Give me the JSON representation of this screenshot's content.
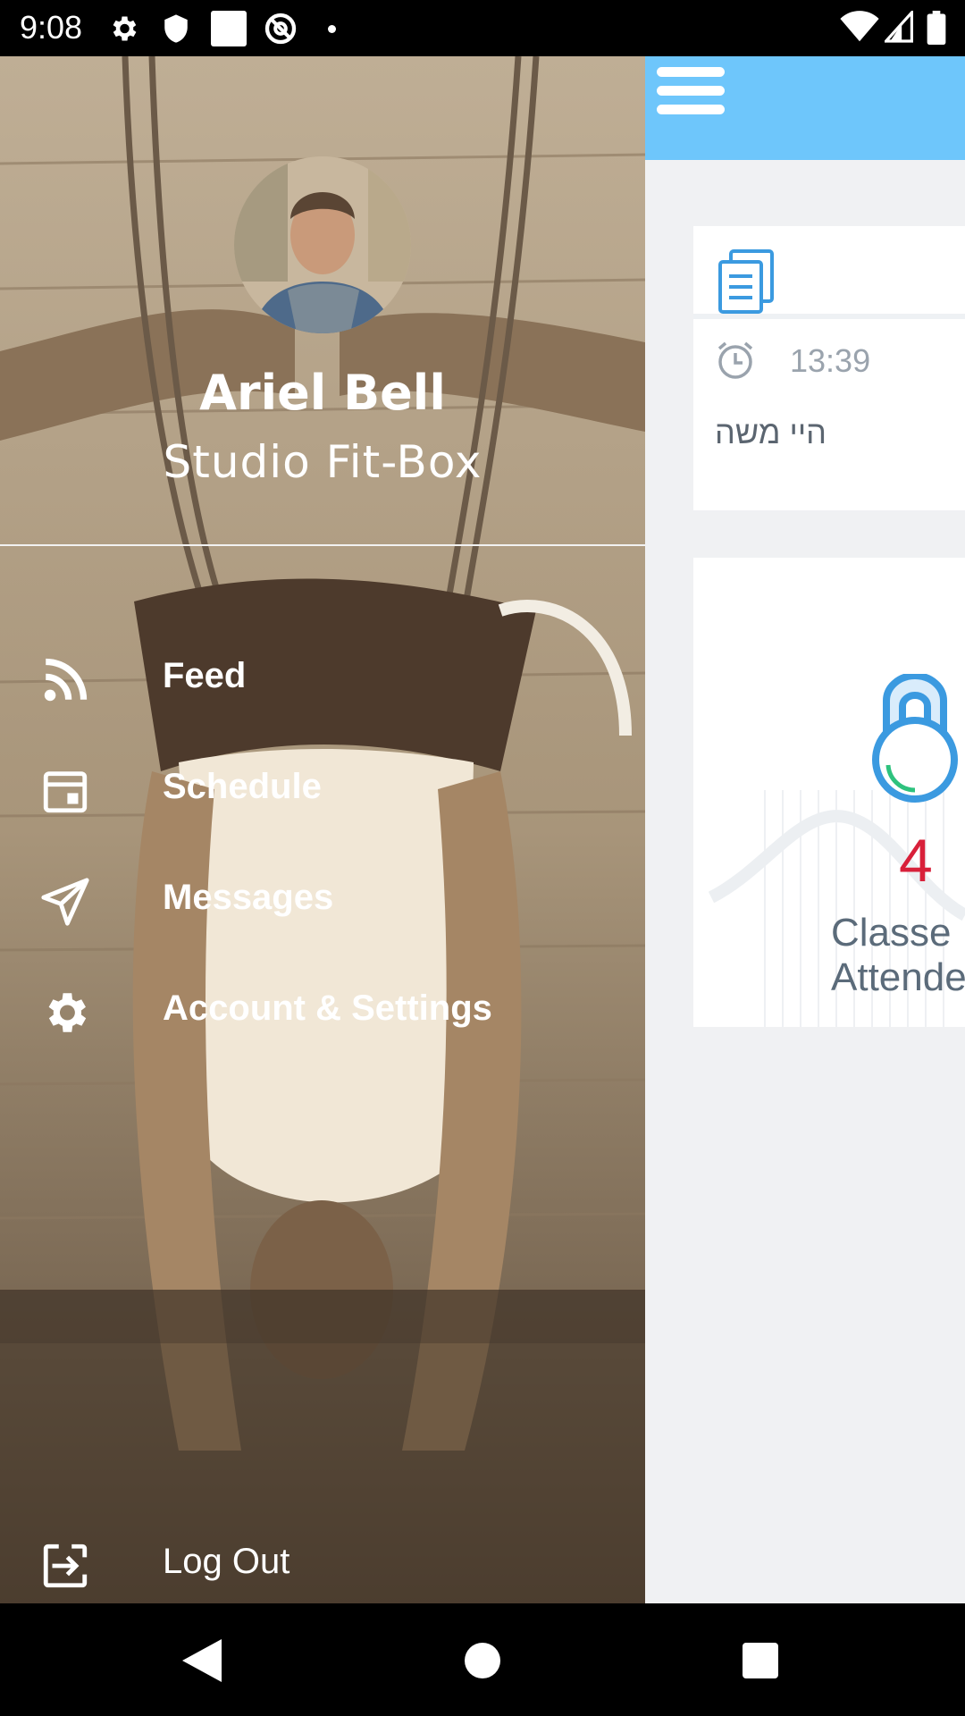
{
  "status_bar": {
    "time": "9:08",
    "left_icons": [
      "gear-icon",
      "shield-icon",
      "square-icon",
      "at-icon",
      "dot-icon"
    ],
    "right_icons": [
      "wifi-icon",
      "signal-icon",
      "battery-icon"
    ]
  },
  "drawer": {
    "user_name": "Ariel Bell",
    "studio_name": "Studio Fit-Box",
    "menu": [
      {
        "label": "Feed",
        "icon": "rss-icon"
      },
      {
        "label": "Schedule",
        "icon": "calendar-icon"
      },
      {
        "label": "Messages",
        "icon": "send-icon"
      },
      {
        "label": "Account & Settings",
        "icon": "gear-icon"
      }
    ],
    "logout": {
      "label": "Log Out",
      "icon": "logout-icon"
    }
  },
  "main": {
    "header_color": "#6ec6fb",
    "menu_icon": "hamburger-icon",
    "message_card": {
      "icon": "document-icon",
      "time": "13:39",
      "text": "היי משה"
    },
    "stats_card": {
      "icon": "kettlebell-icon",
      "count": "4",
      "label_line1": "Classe",
      "label_line2": "Attende"
    }
  },
  "nav_bar": {
    "buttons": [
      "back-icon",
      "home-icon",
      "recents-icon"
    ]
  },
  "colors": {
    "accent": "#6ec6fb",
    "count": "#d8203a",
    "icon_blue": "#3b9ae0"
  }
}
